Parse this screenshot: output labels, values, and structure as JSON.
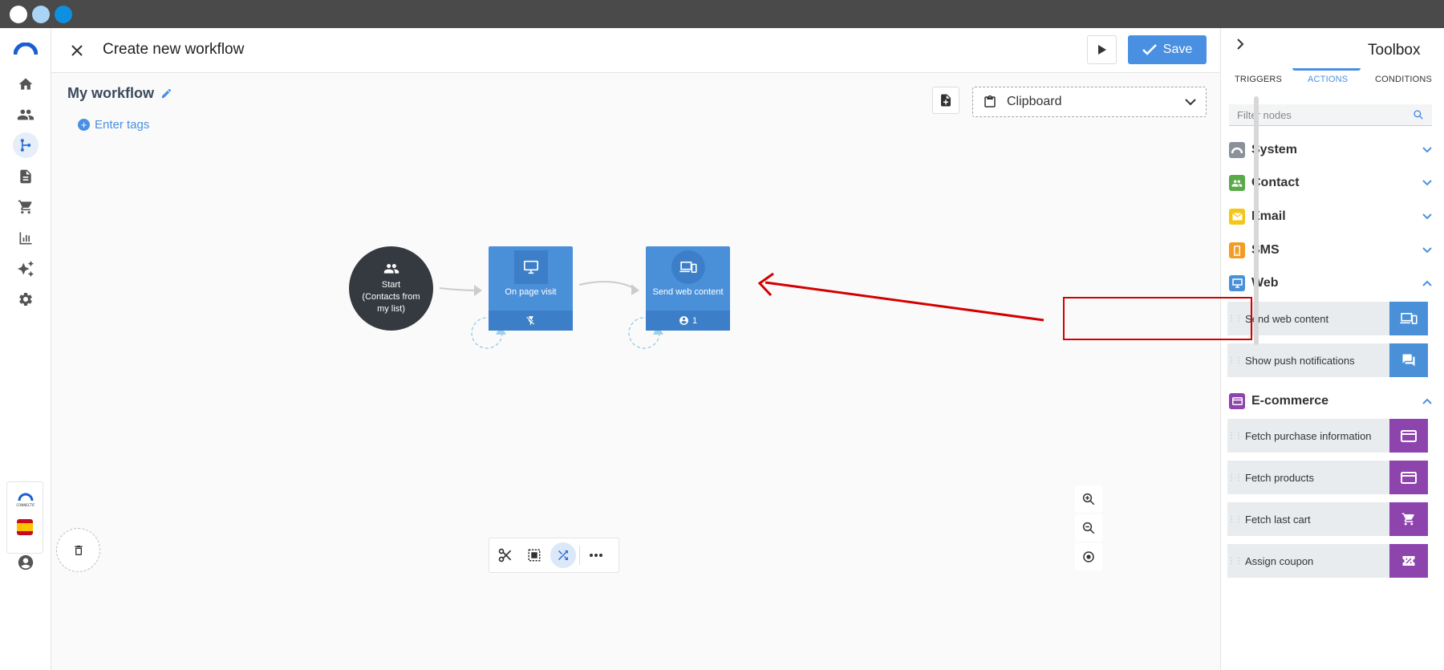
{
  "window": {
    "traffic_lights": [
      "#ffffff",
      "#a9d4f5",
      "#0e8fe0"
    ]
  },
  "sidebar": {
    "items": [
      {
        "name": "logo-icon"
      },
      {
        "name": "home-icon"
      },
      {
        "name": "contacts-icon"
      },
      {
        "name": "workflow-icon"
      },
      {
        "name": "document-icon"
      },
      {
        "name": "cart-icon"
      },
      {
        "name": "chart-icon"
      },
      {
        "name": "sparkles-icon"
      },
      {
        "name": "gear-icon"
      }
    ],
    "brand_small": "CONNECTIF",
    "language_flag": "es"
  },
  "header": {
    "title": "Create new workflow",
    "save_label": "Save"
  },
  "workflow": {
    "name": "My workflow",
    "tags_label": "Enter tags",
    "clipboard_label": "Clipboard",
    "nodes": {
      "start_label": "Start",
      "start_sublabel": "(Contacts from my list)",
      "on_page_visit_label": "On page visit",
      "send_web_content_label": "Send web content",
      "send_web_content_count": "1"
    }
  },
  "toolbox": {
    "title": "Toolbox",
    "tabs": [
      "TRIGGERS",
      "ACTIONS",
      "CONDITIONS"
    ],
    "active_tab": "ACTIONS",
    "filter_placeholder": "Filter nodes",
    "categories": [
      {
        "label": "System",
        "color": "#8a9199",
        "expanded": false
      },
      {
        "label": "Contact",
        "color": "#5aaa4a",
        "expanded": false
      },
      {
        "label": "Email",
        "color": "#f5c518",
        "expanded": false
      },
      {
        "label": "SMS",
        "color": "#f39c24",
        "expanded": false
      },
      {
        "label": "Web",
        "color": "#4a90d9",
        "expanded": true
      },
      {
        "label": "E-commerce",
        "color": "#8e44ad",
        "expanded": true
      }
    ],
    "web_items": [
      "Send web content",
      "Show push notifications"
    ],
    "ecommerce_items": [
      "Fetch purchase information",
      "Fetch products",
      "Fetch last cart",
      "Assign coupon"
    ]
  },
  "colors": {
    "accent": "#4a90e2",
    "node_blue": "#4a90d9",
    "highlight_red": "#d40000"
  }
}
